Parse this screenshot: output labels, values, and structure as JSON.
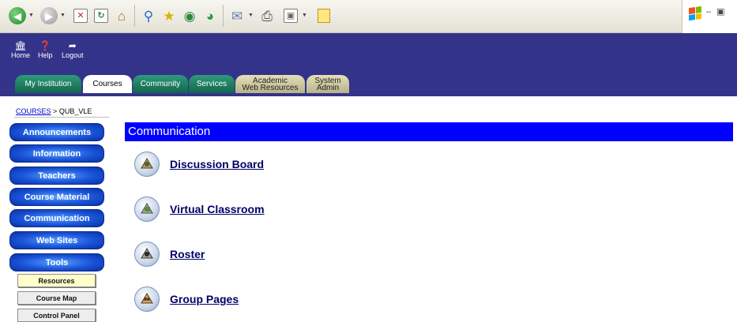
{
  "browser": {
    "icons": [
      "back-icon",
      "forward-icon",
      "stop-icon",
      "refresh-icon",
      "home-icon",
      "search-icon",
      "favorites-icon",
      "media-icon",
      "history-icon",
      "mail-icon",
      "print-icon",
      "edit-icon",
      "discuss-icon"
    ],
    "colors": {
      "toolbar": "#ece9d8"
    }
  },
  "header": {
    "bg_color": "#33338a",
    "buttons": [
      {
        "label": "Home",
        "icon": "home-icon"
      },
      {
        "label": "Help",
        "icon": "help-icon"
      },
      {
        "label": "Logout",
        "icon": "logout-icon"
      }
    ],
    "tabs": [
      {
        "label": "My Institution",
        "style": "green"
      },
      {
        "label": "Courses",
        "style": "active"
      },
      {
        "label": "Community",
        "style": "green"
      },
      {
        "label": "Services",
        "style": "green"
      },
      {
        "label_line1": "Academic",
        "label_line2": "Web Resources",
        "style": "tan"
      },
      {
        "label_line1": "System",
        "label_line2": "Admin",
        "style": "tan"
      }
    ]
  },
  "breadcrumb": {
    "link": "COURSES",
    "separator": ">",
    "current": "QUB_VLE"
  },
  "nav": {
    "items": [
      {
        "label": "Announcements"
      },
      {
        "label": "Information"
      },
      {
        "label": "Teachers"
      },
      {
        "label": "Course Material"
      },
      {
        "label": "Communication"
      },
      {
        "label": "Web Sites"
      },
      {
        "label": "Tools"
      }
    ],
    "sub_items": [
      {
        "label": "Resources",
        "active": true
      },
      {
        "label": "Course Map",
        "active": false
      },
      {
        "label": "Control Panel",
        "active": false
      }
    ]
  },
  "main": {
    "title": "Communication",
    "title_bg": "#0000ff",
    "items": [
      {
        "label": "Discussion Board",
        "icon": "discussion-board-icon"
      },
      {
        "label": "Virtual Classroom",
        "icon": "virtual-classroom-icon"
      },
      {
        "label": "Roster",
        "icon": "roster-icon"
      },
      {
        "label": "Group Pages",
        "icon": "group-pages-icon"
      }
    ]
  }
}
